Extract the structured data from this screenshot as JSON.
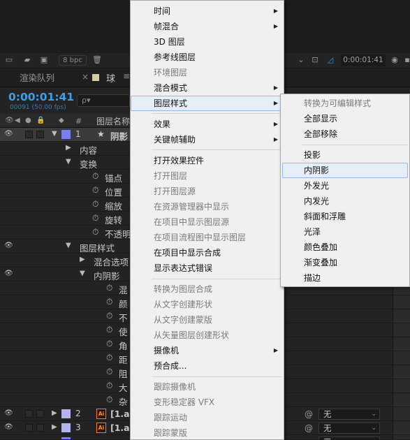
{
  "project_toolbar": {
    "bpc": "8 bpc",
    "timecode": "0:00:01:41"
  },
  "timeline": {
    "render_queue_tab": "渲染队列",
    "comp_tab": "球",
    "timecode": "0:00:01:41",
    "frame_info": "00091 (50.00 fps)",
    "search_placeholder": "ρ▾",
    "col_hash": "#",
    "col_layer_name": "图层名称",
    "layers": [
      {
        "num": "1",
        "name": "阴影",
        "label_color": "#7a7ef0"
      },
      {
        "num": "2",
        "name": "[1.ai",
        "label_color": "#b4b4e8",
        "blend": "无"
      },
      {
        "num": "3",
        "name": "[1.ai",
        "label_color": "#b4b4e8",
        "blend": "无"
      },
      {
        "num": "",
        "name": "",
        "label_color": "#7a7ef0",
        "blend": "无"
      }
    ],
    "tree": {
      "content": "内容",
      "transform": "变换",
      "anchor": "锚点",
      "position": "位置",
      "scale": "缩放",
      "rotation": "旋转",
      "opacity": "不透明",
      "layer_styles": "图层样式",
      "blend_options": "混合选项",
      "inner_shadow": "内阴影",
      "props": [
        "混",
        "颜",
        "不",
        "使",
        "角",
        "距",
        "阻",
        "大",
        "杂"
      ]
    }
  },
  "main_menu": {
    "items": [
      {
        "label": "时间",
        "submenu": true,
        "enabled": true
      },
      {
        "label": "帧混合",
        "submenu": true,
        "enabled": true
      },
      {
        "label": "3D 图层",
        "enabled": true
      },
      {
        "label": "参考线图层",
        "enabled": true
      },
      {
        "label": "环境图层",
        "enabled": false
      },
      {
        "label": "混合模式",
        "submenu": true,
        "enabled": true
      },
      {
        "label": "图层样式",
        "submenu": true,
        "enabled": true,
        "highlighted": true
      },
      {
        "label": "效果",
        "submenu": true,
        "enabled": true
      },
      {
        "label": "关键帧辅助",
        "submenu": true,
        "enabled": true
      },
      {
        "label": "打开效果控件",
        "enabled": true
      },
      {
        "label": "打开图层",
        "enabled": false
      },
      {
        "label": "打开图层源",
        "enabled": false
      },
      {
        "label": "在资源管理器中显示",
        "enabled": false
      },
      {
        "label": "在项目中显示图层源",
        "enabled": false
      },
      {
        "label": "在项目流程图中显示图层",
        "enabled": false
      },
      {
        "label": "在项目中显示合成",
        "enabled": true
      },
      {
        "label": "显示表达式错误",
        "enabled": true
      },
      {
        "label": "转换为图层合成",
        "enabled": false
      },
      {
        "label": "从文字创建形状",
        "enabled": false
      },
      {
        "label": "从文字创建蒙版",
        "enabled": false
      },
      {
        "label": "从矢量图层创建形状",
        "enabled": false
      },
      {
        "label": "摄像机",
        "submenu": true,
        "enabled": true
      },
      {
        "label": "预合成...",
        "enabled": true
      },
      {
        "label": "跟踪摄像机",
        "enabled": false
      },
      {
        "label": "变形稳定器 VFX",
        "enabled": false
      },
      {
        "label": "跟踪运动",
        "enabled": false
      },
      {
        "label": "跟踪蒙版",
        "enabled": false
      }
    ]
  },
  "layer_style_submenu": {
    "items": [
      {
        "label": "转换为可编辑样式",
        "enabled": false
      },
      {
        "label": "全部显示",
        "enabled": true
      },
      {
        "label": "全部移除",
        "enabled": true
      },
      {
        "label": "投影",
        "enabled": true
      },
      {
        "label": "内阴影",
        "enabled": true,
        "highlighted": true
      },
      {
        "label": "外发光",
        "enabled": true
      },
      {
        "label": "内发光",
        "enabled": true
      },
      {
        "label": "斜面和浮雕",
        "enabled": true
      },
      {
        "label": "光泽",
        "enabled": true
      },
      {
        "label": "颜色叠加",
        "enabled": true
      },
      {
        "label": "渐变叠加",
        "enabled": true
      },
      {
        "label": "描边",
        "enabled": true
      }
    ]
  }
}
